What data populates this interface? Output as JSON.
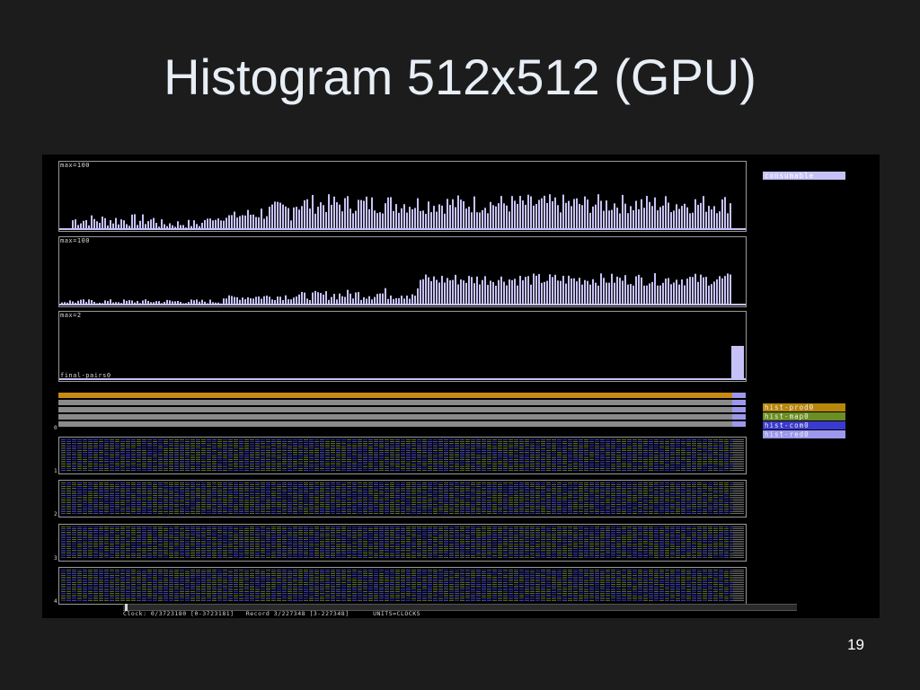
{
  "slide": {
    "title": "Histogram 512x512 (GPU)",
    "page_number": "19"
  },
  "graphs": [
    {
      "max_label": "max=100",
      "bottom_label": "",
      "color": "#c6c2f7"
    },
    {
      "max_label": "max=100",
      "bottom_label": "",
      "color": "#c6c2f7"
    },
    {
      "max_label": "max=2",
      "bottom_label": "final-pairs0",
      "color": "#c6c2f7"
    }
  ],
  "top_legend": {
    "label": "consumable",
    "color": "#c6c2f7"
  },
  "stream_legend": [
    {
      "label": "hist-prod0",
      "color": "#b8860b"
    },
    {
      "label": "hist-map0",
      "color": "#6b8e23"
    },
    {
      "label": "hist-com0",
      "color": "#3a3ad0"
    },
    {
      "label": "hist-red0",
      "color": "#9d98ec"
    }
  ],
  "row_labels": [
    "0",
    "1",
    "2",
    "3",
    "4"
  ],
  "status": {
    "clock": "Clock: 0/3723180 [0-3723181]",
    "record": "Record 3/227348 [3-227348]",
    "units": "UNITS=CLOCKS"
  }
}
